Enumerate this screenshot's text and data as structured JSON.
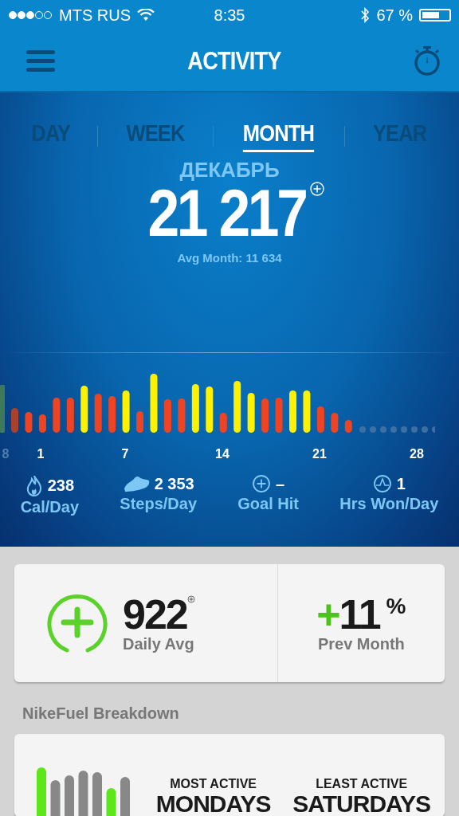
{
  "status_bar": {
    "carrier": "MTS RUS",
    "time": "8:35",
    "battery": "67 %"
  },
  "nav": {
    "title": "ACTIVITY"
  },
  "tabs": [
    {
      "label": "DAY",
      "selected": false
    },
    {
      "label": "WEEK",
      "selected": false
    },
    {
      "label": "MONTH",
      "selected": true
    },
    {
      "label": "YEAR",
      "selected": false
    }
  ],
  "period": {
    "name": "ДЕКАБРЬ",
    "total": "21 217",
    "average": "Avg Month: 11 634"
  },
  "day_labels": [
    {
      "label": "8",
      "dimmed": true
    },
    {
      "label": "1",
      "dimmed": false
    },
    {
      "label": "7",
      "dimmed": false
    },
    {
      "label": "14",
      "dimmed": false
    },
    {
      "label": "21",
      "dimmed": false
    },
    {
      "label": "28",
      "dimmed": false
    }
  ],
  "stats": [
    {
      "kind": "calories",
      "value": "238",
      "label": "Cal/Day"
    },
    {
      "kind": "steps",
      "value": "2 353",
      "label": "Steps/Day"
    },
    {
      "kind": "goal",
      "value": "–",
      "label": "Goal Hit"
    },
    {
      "kind": "hours",
      "value": "1",
      "label": "Hrs Won/Day"
    }
  ],
  "summary": {
    "value": "922",
    "label": "Daily Avg",
    "change_sign": "+",
    "change": "11",
    "unit": "%",
    "change_label": "Prev Month"
  },
  "breakdown": {
    "heading": "NikeFuel Breakdown",
    "most_caption": "MOST ACTIVE",
    "most_day": "MONDAYS",
    "least_caption": "LEAST ACTIVE",
    "least_day": "SATURDAYS"
  }
}
